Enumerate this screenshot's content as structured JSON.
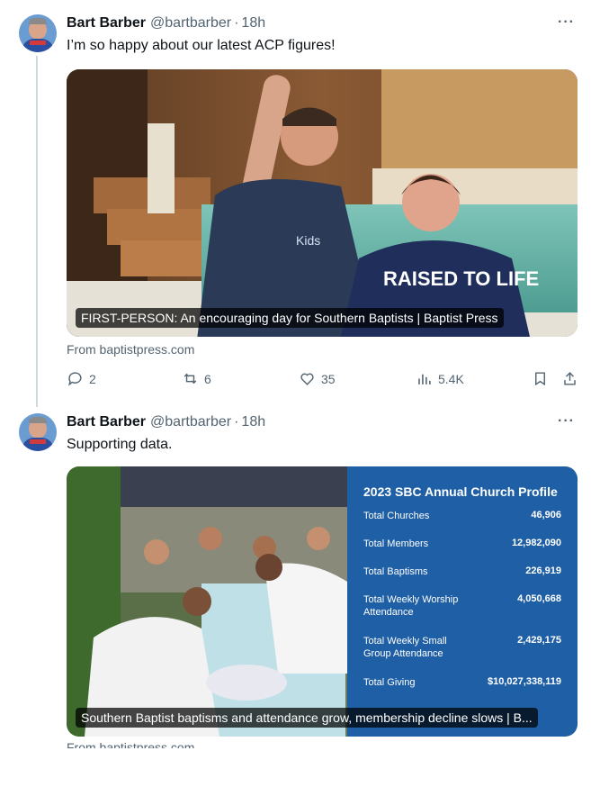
{
  "tweets": [
    {
      "author_name": "Bart Barber",
      "handle": "@bartbarber",
      "separator": "·",
      "time": "18h",
      "text": "I’m so happy about our latest ACP figures!",
      "card_caption": "FIRST-PERSON: An encouraging day for Southern Baptists | Baptist Press",
      "source": "From baptistpress.com",
      "actions": {
        "replies": "2",
        "reposts": "6",
        "likes": "35",
        "views": "5.4K"
      }
    },
    {
      "author_name": "Bart Barber",
      "handle": "@bartbarber",
      "separator": "·",
      "time": "18h",
      "text": "Supporting data.",
      "card_caption": "Southern Baptist baptisms and attendance grow, membership decline slows | B...",
      "source": "From baptistpress.com",
      "stats": {
        "title": "2023 SBC Annual Church Profile",
        "rows": [
          {
            "label": "Total Churches",
            "value": "46,906"
          },
          {
            "label": "Total Members",
            "value": "12,982,090"
          },
          {
            "label": "Total Baptisms",
            "value": "226,919"
          },
          {
            "label": "Total Weekly Worship Attendance",
            "value": "4,050,668"
          },
          {
            "label": "Total Weekly Small Group Attendance",
            "value": "2,429,175"
          },
          {
            "label": "Total Giving",
            "value": "$10,027,338,119"
          }
        ]
      }
    }
  ],
  "image1_shirt_text": "RAISED TO LIFE",
  "image1_logo_text": "Kids",
  "icons": [
    "more-icon",
    "reply-icon",
    "repost-icon",
    "like-icon",
    "views-icon",
    "bookmark-icon",
    "share-icon"
  ]
}
